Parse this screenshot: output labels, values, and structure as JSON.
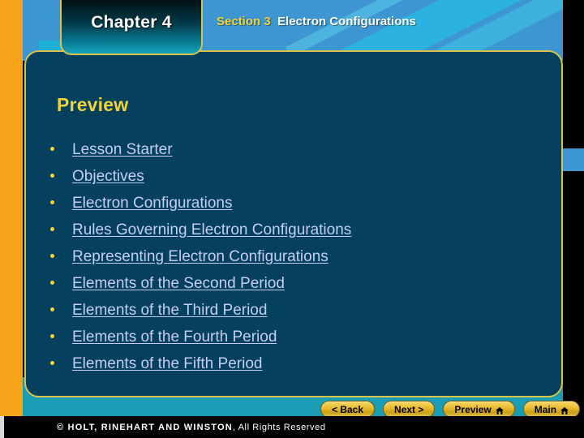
{
  "slide": {
    "chapter_tab_label": "Chapter 4",
    "section_number": "Section 3",
    "section_name": "Electron Configurations",
    "heading": "Preview"
  },
  "colors": {
    "panel_background": "#06405f",
    "header_blue": "#3d95d1",
    "accent_gold": "#f2d33a",
    "rail_orange": "#f7a41a",
    "teal_band": "#1a9cb5",
    "link_blue": "#c3cef0",
    "border_gold": "#d8c24a"
  },
  "preview_links": [
    {
      "label": "Lesson Starter"
    },
    {
      "label": "Objectives"
    },
    {
      "label": "Electron Configurations"
    },
    {
      "label": "Rules Governing Electron Configurations"
    },
    {
      "label": "Representing Electron Configurations"
    },
    {
      "label": "Elements of the Second Period"
    },
    {
      "label": "Elements of the Third Period"
    },
    {
      "label": "Elements of the Fourth Period"
    },
    {
      "label": "Elements of the Fifth Period"
    }
  ],
  "nav_buttons": [
    {
      "label": "< Back",
      "icon": ""
    },
    {
      "label": "Next >",
      "icon": ""
    },
    {
      "label": "Preview",
      "icon": "home-icon"
    },
    {
      "label": "Main",
      "icon": "home-icon"
    }
  ],
  "footer": {
    "company": "© HOLT, RINEHART AND WINSTON",
    "rights": ", All Rights Reserved"
  }
}
